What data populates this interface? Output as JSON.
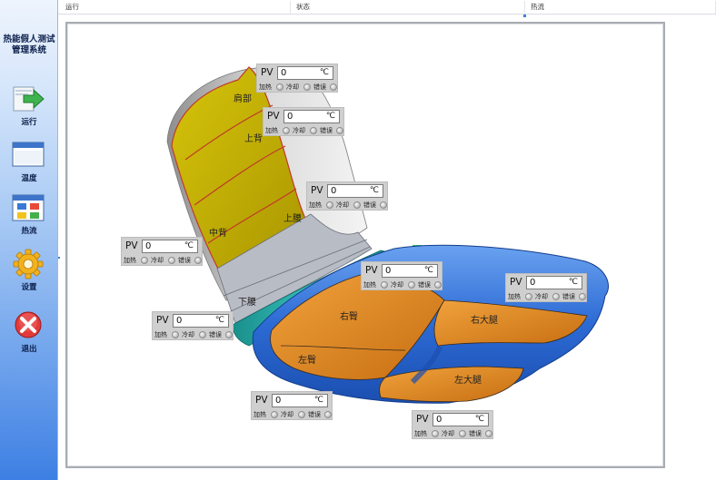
{
  "app": {
    "title_line1": "热能假人测试",
    "title_line2": "管理系统"
  },
  "tabs": [
    {
      "label": "运行"
    },
    {
      "label": "状态"
    },
    {
      "label": "热流"
    }
  ],
  "sidebar": {
    "items": [
      {
        "label": "运行",
        "icon": "arrow-right-icon"
      },
      {
        "label": "温度",
        "icon": "window-icon"
      },
      {
        "label": "热流",
        "icon": "grid-color-icon"
      },
      {
        "label": "设置",
        "icon": "gear-icon"
      },
      {
        "label": "退出",
        "icon": "close-icon"
      }
    ]
  },
  "regions": {
    "shoulder": "肩部",
    "upper_back": "上背",
    "mid_back": "中背",
    "upper_waist": "上腰",
    "lower_waist": "下腰",
    "right_hip": "右臀",
    "left_hip": "左臀",
    "right_thigh": "右大腿",
    "left_thigh": "左大腿"
  },
  "pv_common": {
    "pv_label": "PV",
    "unit": "℃",
    "heat_label": "加热",
    "cool_label": "冷却",
    "error_label": "错误"
  },
  "pv_panels": [
    {
      "value": "0"
    },
    {
      "value": "0"
    },
    {
      "value": "0"
    },
    {
      "value": "0"
    },
    {
      "value": "0"
    },
    {
      "value": "0"
    },
    {
      "value": "0"
    },
    {
      "value": "0"
    },
    {
      "value": "0"
    }
  ],
  "colors": {
    "accent": "#3d7fe3",
    "back_panel": "#c8b400",
    "hip_panel": "#d9801f",
    "seat_shell": "#2f6fd6",
    "waist_ring": "#22a5a0",
    "led_off": "#c9c9c9"
  }
}
